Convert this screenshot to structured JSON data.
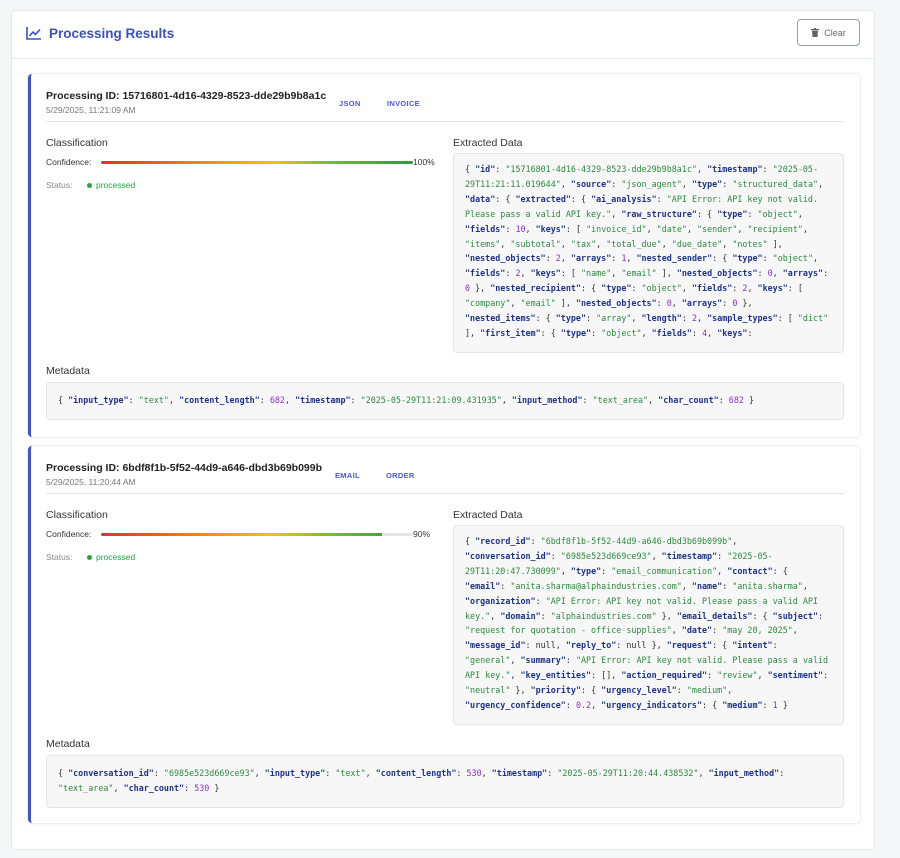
{
  "header": {
    "title": "Processing Results",
    "clear_label": "Clear"
  },
  "results": [
    {
      "processing_id": "Processing ID: 15716801-4d16-4329-8523-dde29b9b8a1c",
      "timestamp": "5/29/2025, 11:21:09 AM",
      "tags": [
        "JSON",
        "INVOICE"
      ],
      "classification_label": "Classification",
      "confidence_label": "Confidence:",
      "confidence": 100,
      "confidence_text": "100%",
      "status_label": "Status:",
      "status": "processed",
      "extracted_label": "Extracted Data",
      "extracted_tokens": [
        [
          "p",
          "{ "
        ],
        [
          "k",
          "\"id\""
        ],
        [
          "p",
          ": "
        ],
        [
          "s",
          "\"15716801-4d16-4329-8523-dde29b9b8a1c\""
        ],
        [
          "p",
          ", "
        ],
        [
          "k",
          "\"timestamp\""
        ],
        [
          "p",
          ": "
        ],
        [
          "s",
          "\"2025-05-29T11:21:11.019644\""
        ],
        [
          "p",
          ", "
        ],
        [
          "k",
          "\"source\""
        ],
        [
          "p",
          ": "
        ],
        [
          "s",
          "\"json_agent\""
        ],
        [
          "p",
          ", "
        ],
        [
          "k",
          "\"type\""
        ],
        [
          "p",
          ": "
        ],
        [
          "s",
          "\"structured_data\""
        ],
        [
          "p",
          ", "
        ],
        [
          "k",
          "\"data\""
        ],
        [
          "p",
          ": { "
        ],
        [
          "k",
          "\"extracted\""
        ],
        [
          "p",
          ": { "
        ],
        [
          "k",
          "\"ai_analysis\""
        ],
        [
          "p",
          ": "
        ],
        [
          "s",
          "\"API Error: API key not valid. Please pass a valid API key.\""
        ],
        [
          "p",
          ", "
        ],
        [
          "k",
          "\"raw_structure\""
        ],
        [
          "p",
          ": { "
        ],
        [
          "k",
          "\"type\""
        ],
        [
          "p",
          ": "
        ],
        [
          "s",
          "\"object\""
        ],
        [
          "p",
          ", "
        ],
        [
          "k",
          "\"fields\""
        ],
        [
          "p",
          ": "
        ],
        [
          "n",
          "10"
        ],
        [
          "p",
          ", "
        ],
        [
          "k",
          "\"keys\""
        ],
        [
          "p",
          ": [ "
        ],
        [
          "s",
          "\"invoice_id\""
        ],
        [
          "p",
          ", "
        ],
        [
          "s",
          "\"date\""
        ],
        [
          "p",
          ", "
        ],
        [
          "s",
          "\"sender\""
        ],
        [
          "p",
          ", "
        ],
        [
          "s",
          "\"recipient\""
        ],
        [
          "p",
          ", "
        ],
        [
          "s",
          "\"items\""
        ],
        [
          "p",
          ", "
        ],
        [
          "s",
          "\"subtotal\""
        ],
        [
          "p",
          ", "
        ],
        [
          "s",
          "\"tax\""
        ],
        [
          "p",
          ", "
        ],
        [
          "s",
          "\"total_due\""
        ],
        [
          "p",
          ", "
        ],
        [
          "s",
          "\"due_date\""
        ],
        [
          "p",
          ", "
        ],
        [
          "s",
          "\"notes\""
        ],
        [
          "p",
          " ], "
        ],
        [
          "k",
          "\"nested_objects\""
        ],
        [
          "p",
          ": "
        ],
        [
          "n",
          "2"
        ],
        [
          "p",
          ", "
        ],
        [
          "k",
          "\"arrays\""
        ],
        [
          "p",
          ": "
        ],
        [
          "n",
          "1"
        ],
        [
          "p",
          ", "
        ],
        [
          "k",
          "\"nested_sender\""
        ],
        [
          "p",
          ": { "
        ],
        [
          "k",
          "\"type\""
        ],
        [
          "p",
          ": "
        ],
        [
          "s",
          "\"object\""
        ],
        [
          "p",
          ", "
        ],
        [
          "k",
          "\"fields\""
        ],
        [
          "p",
          ": "
        ],
        [
          "n",
          "2"
        ],
        [
          "p",
          ", "
        ],
        [
          "k",
          "\"keys\""
        ],
        [
          "p",
          ": [ "
        ],
        [
          "s",
          "\"name\""
        ],
        [
          "p",
          ", "
        ],
        [
          "s",
          "\"email\""
        ],
        [
          "p",
          " ], "
        ],
        [
          "k",
          "\"nested_objects\""
        ],
        [
          "p",
          ": "
        ],
        [
          "n",
          "0"
        ],
        [
          "p",
          ", "
        ],
        [
          "k",
          "\"arrays\""
        ],
        [
          "p",
          ": "
        ],
        [
          "n",
          "0"
        ],
        [
          "p",
          " }, "
        ],
        [
          "k",
          "\"nested_recipient\""
        ],
        [
          "p",
          ": { "
        ],
        [
          "k",
          "\"type\""
        ],
        [
          "p",
          ": "
        ],
        [
          "s",
          "\"object\""
        ],
        [
          "p",
          ", "
        ],
        [
          "k",
          "\"fields\""
        ],
        [
          "p",
          ": "
        ],
        [
          "n",
          "2"
        ],
        [
          "p",
          ", "
        ],
        [
          "k",
          "\"keys\""
        ],
        [
          "p",
          ": [ "
        ],
        [
          "s",
          "\"company\""
        ],
        [
          "p",
          ", "
        ],
        [
          "s",
          "\"email\""
        ],
        [
          "p",
          " ], "
        ],
        [
          "k",
          "\"nested_objects\""
        ],
        [
          "p",
          ": "
        ],
        [
          "n",
          "0"
        ],
        [
          "p",
          ", "
        ],
        [
          "k",
          "\"arrays\""
        ],
        [
          "p",
          ": "
        ],
        [
          "n",
          "0"
        ],
        [
          "p",
          " }, "
        ],
        [
          "k",
          "\"nested_items\""
        ],
        [
          "p",
          ": { "
        ],
        [
          "k",
          "\"type\""
        ],
        [
          "p",
          ": "
        ],
        [
          "s",
          "\"array\""
        ],
        [
          "p",
          ", "
        ],
        [
          "k",
          "\"length\""
        ],
        [
          "p",
          ": "
        ],
        [
          "n",
          "2"
        ],
        [
          "p",
          ", "
        ],
        [
          "k",
          "\"sample_types\""
        ],
        [
          "p",
          ": [ "
        ],
        [
          "s",
          "\"dict\""
        ],
        [
          "p",
          " ], "
        ],
        [
          "k",
          "\"first_item\""
        ],
        [
          "p",
          ": { "
        ],
        [
          "k",
          "\"type\""
        ],
        [
          "p",
          ": "
        ],
        [
          "s",
          "\"object\""
        ],
        [
          "p",
          ", "
        ],
        [
          "k",
          "\"fields\""
        ],
        [
          "p",
          ": "
        ],
        [
          "n",
          "4"
        ],
        [
          "p",
          ", "
        ],
        [
          "k",
          "\"keys\""
        ],
        [
          "p",
          ": "
        ]
      ],
      "metadata_label": "Metadata",
      "metadata_tokens": [
        [
          "p",
          "{ "
        ],
        [
          "k",
          "\"input_type\""
        ],
        [
          "p",
          ": "
        ],
        [
          "s",
          "\"text\""
        ],
        [
          "p",
          ", "
        ],
        [
          "k",
          "\"content_length\""
        ],
        [
          "p",
          ": "
        ],
        [
          "n",
          "682"
        ],
        [
          "p",
          ", "
        ],
        [
          "k",
          "\"timestamp\""
        ],
        [
          "p",
          ": "
        ],
        [
          "s",
          "\"2025-05-29T11:21:09.431935\""
        ],
        [
          "p",
          ", "
        ],
        [
          "k",
          "\"input_method\""
        ],
        [
          "p",
          ": "
        ],
        [
          "s",
          "\"text_area\""
        ],
        [
          "p",
          ", "
        ],
        [
          "k",
          "\"char_count\""
        ],
        [
          "p",
          ": "
        ],
        [
          "n",
          "682"
        ],
        [
          "p",
          " }"
        ]
      ]
    },
    {
      "processing_id": "Processing ID: 6bdf8f1b-5f52-44d9-a646-dbd3b69b099b",
      "timestamp": "5/29/2025, 11:20:44 AM",
      "tags": [
        "EMAIL",
        "ORDER"
      ],
      "classification_label": "Classification",
      "confidence_label": "Confidence:",
      "confidence": 90,
      "confidence_text": "90%",
      "status_label": "Status:",
      "status": "processed",
      "extracted_label": "Extracted Data",
      "extracted_tokens": [
        [
          "p",
          "{ "
        ],
        [
          "k",
          "\"record_id\""
        ],
        [
          "p",
          ": "
        ],
        [
          "s",
          "\"6bdf8f1b-5f52-44d9-a646-dbd3b69b099b\""
        ],
        [
          "p",
          ", "
        ],
        [
          "k",
          "\"conversation_id\""
        ],
        [
          "p",
          ": "
        ],
        [
          "s",
          "\"6985e523d669ce93\""
        ],
        [
          "p",
          ", "
        ],
        [
          "k",
          "\"timestamp\""
        ],
        [
          "p",
          ": "
        ],
        [
          "s",
          "\"2025-05-29T11:20:47.730099\""
        ],
        [
          "p",
          ", "
        ],
        [
          "k",
          "\"type\""
        ],
        [
          "p",
          ": "
        ],
        [
          "s",
          "\"email_communication\""
        ],
        [
          "p",
          ", "
        ],
        [
          "k",
          "\"contact\""
        ],
        [
          "p",
          ": { "
        ],
        [
          "k",
          "\"email\""
        ],
        [
          "p",
          ": "
        ],
        [
          "s",
          "\"anita.sharma@alphaindustries.com\""
        ],
        [
          "p",
          ", "
        ],
        [
          "k",
          "\"name\""
        ],
        [
          "p",
          ": "
        ],
        [
          "s",
          "\"anita.sharma\""
        ],
        [
          "p",
          ", "
        ],
        [
          "k",
          "\"organization\""
        ],
        [
          "p",
          ": "
        ],
        [
          "s",
          "\"API Error: API key not valid. Please pass a valid API key.\""
        ],
        [
          "p",
          ", "
        ],
        [
          "k",
          "\"domain\""
        ],
        [
          "p",
          ": "
        ],
        [
          "s",
          "\"alphaindustries.com\""
        ],
        [
          "p",
          " }, "
        ],
        [
          "k",
          "\"email_details\""
        ],
        [
          "p",
          ": { "
        ],
        [
          "k",
          "\"subject\""
        ],
        [
          "p",
          ": "
        ],
        [
          "s",
          "\"request for quotation - office supplies\""
        ],
        [
          "p",
          ", "
        ],
        [
          "k",
          "\"date\""
        ],
        [
          "p",
          ": "
        ],
        [
          "s",
          "\"may 20, 2025\""
        ],
        [
          "p",
          ", "
        ],
        [
          "k",
          "\"message_id\""
        ],
        [
          "p",
          ": null, "
        ],
        [
          "k",
          "\"reply_to\""
        ],
        [
          "p",
          ": null }, "
        ],
        [
          "k",
          "\"request\""
        ],
        [
          "p",
          ": { "
        ],
        [
          "k",
          "\"intent\""
        ],
        [
          "p",
          ": "
        ],
        [
          "s",
          "\"general\""
        ],
        [
          "p",
          ", "
        ],
        [
          "k",
          "\"summary\""
        ],
        [
          "p",
          ": "
        ],
        [
          "s",
          "\"API Error: API key not valid. Please pass a valid API key.\""
        ],
        [
          "p",
          ", "
        ],
        [
          "k",
          "\"key_entities\""
        ],
        [
          "p",
          ": [], "
        ],
        [
          "k",
          "\"action_required\""
        ],
        [
          "p",
          ": "
        ],
        [
          "s",
          "\"review\""
        ],
        [
          "p",
          ", "
        ],
        [
          "k",
          "\"sentiment\""
        ],
        [
          "p",
          ": "
        ],
        [
          "s",
          "\"neutral\""
        ],
        [
          "p",
          " }, "
        ],
        [
          "k",
          "\"priority\""
        ],
        [
          "p",
          ": { "
        ],
        [
          "k",
          "\"urgency_level\""
        ],
        [
          "p",
          ": "
        ],
        [
          "s",
          "\"medium\""
        ],
        [
          "p",
          ", "
        ],
        [
          "k",
          "\"urgency_confidence\""
        ],
        [
          "p",
          ": "
        ],
        [
          "n",
          "0.2"
        ],
        [
          "p",
          ", "
        ],
        [
          "k",
          "\"urgency_indicators\""
        ],
        [
          "p",
          ": { "
        ],
        [
          "k",
          "\"medium\""
        ],
        [
          "p",
          ": "
        ],
        [
          "n",
          "1"
        ],
        [
          "p",
          " }"
        ]
      ],
      "metadata_label": "Metadata",
      "metadata_tokens": [
        [
          "p",
          "{ "
        ],
        [
          "k",
          "\"conversation_id\""
        ],
        [
          "p",
          ": "
        ],
        [
          "s",
          "\"6985e523d669ce93\""
        ],
        [
          "p",
          ", "
        ],
        [
          "k",
          "\"input_type\""
        ],
        [
          "p",
          ": "
        ],
        [
          "s",
          "\"text\""
        ],
        [
          "p",
          ", "
        ],
        [
          "k",
          "\"content_length\""
        ],
        [
          "p",
          ": "
        ],
        [
          "n",
          "530"
        ],
        [
          "p",
          ", "
        ],
        [
          "k",
          "\"timestamp\""
        ],
        [
          "p",
          ": "
        ],
        [
          "s",
          "\"2025-05-29T11:20:44.438532\""
        ],
        [
          "p",
          ", "
        ],
        [
          "k",
          "\"input_method\""
        ],
        [
          "p",
          ": "
        ],
        [
          "s",
          "\"text_area\""
        ],
        [
          "p",
          ", "
        ],
        [
          "k",
          "\"char_count\""
        ],
        [
          "p",
          ": "
        ],
        [
          "n",
          "530"
        ],
        [
          "p",
          " }"
        ]
      ]
    }
  ]
}
